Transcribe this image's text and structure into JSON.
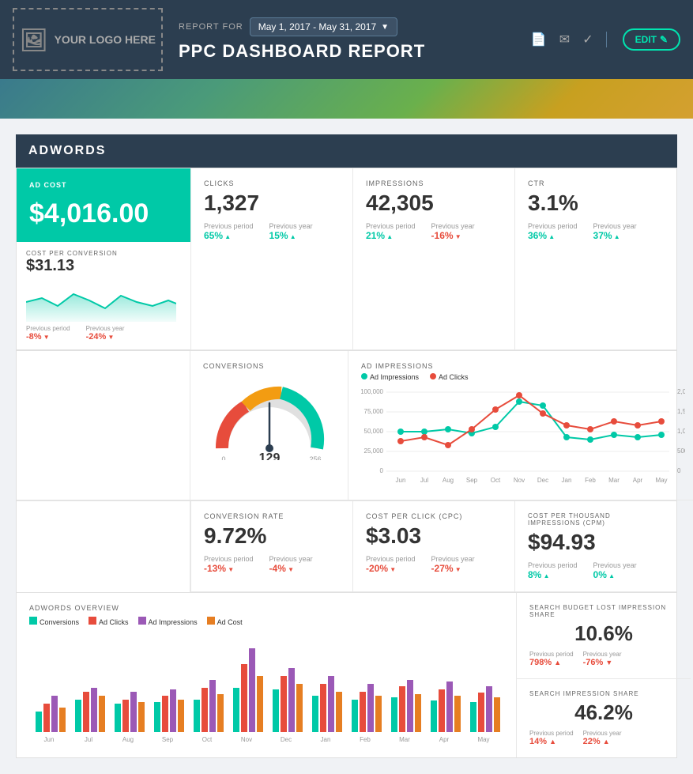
{
  "header": {
    "logo_text": "YOUR LOGO HERE",
    "report_for_label": "REPORT FOR",
    "date_range": "May 1, 2017 - May 31, 2017",
    "page_title": "PPC DASHBOARD REPORT",
    "edit_label": "EDIT",
    "icons": [
      "pdf-icon",
      "email-icon",
      "check-icon"
    ]
  },
  "adwords": {
    "section_label": "ADWORDS",
    "ad_cost": {
      "label": "AD COST",
      "value": "$4,016.00",
      "cost_per_conv_label": "COST PER CONVERSION",
      "cost_per_conv_value": "$31.13",
      "prev_period_label": "Previous period",
      "prev_period_value": "-8%",
      "prev_year_label": "Previous year",
      "prev_year_value": "-24%"
    },
    "clicks": {
      "label": "CLICKS",
      "value": "1,327",
      "prev_period_label": "Previous period",
      "prev_period_value": "65%",
      "prev_year_label": "Previous year",
      "prev_year_value": "15%"
    },
    "impressions": {
      "label": "IMPRESSIONS",
      "value": "42,305",
      "prev_period_label": "Previous period",
      "prev_period_value": "21%",
      "prev_year_label": "Previous year",
      "prev_year_value": "-16%"
    },
    "ctr": {
      "label": "CTR",
      "value": "3.1%",
      "prev_period_label": "Previous period",
      "prev_period_value": "36%",
      "prev_year_label": "Previous year",
      "prev_year_value": "37%"
    },
    "conversions": {
      "label": "CONVERSIONS",
      "value": "129",
      "min": "0",
      "max": "256"
    },
    "ad_impressions_chart": {
      "label": "AD IMPRESSIONS",
      "legend_impressions": "Ad Impressions",
      "legend_clicks": "Ad Clicks",
      "months": [
        "Jun",
        "Jul",
        "Aug",
        "Sep",
        "Oct",
        "Nov",
        "Dec",
        "Jan",
        "Feb",
        "Mar",
        "Apr",
        "May"
      ]
    },
    "conversion_rate": {
      "label": "CONVERSION RATE",
      "value": "9.72%",
      "prev_period_label": "Previous period",
      "prev_period_value": "-13%",
      "prev_year_label": "Previous year",
      "prev_year_value": "-4%"
    },
    "cpc": {
      "label": "COST PER CLICK (CPC)",
      "value": "$3.03",
      "prev_period_label": "Previous period",
      "prev_period_value": "-20%",
      "prev_year_label": "Previous year",
      "prev_year_value": "-27%"
    },
    "cpm": {
      "label": "COST PER THOUSAND IMPRESSIONS (CPM)",
      "value": "$94.93",
      "prev_period_label": "Previous period",
      "prev_period_value": "8%",
      "prev_year_label": "Previous year",
      "prev_year_value": "0%"
    },
    "overview": {
      "label": "ADWORDS OVERVIEW",
      "legend_conversions": "Conversions",
      "legend_ad_clicks": "Ad Clicks",
      "legend_ad_impressions": "Ad Impressions",
      "legend_ad_cost": "Ad Cost",
      "months": [
        "Jun",
        "Jul",
        "Aug",
        "Sep",
        "Oct",
        "Nov",
        "Dec",
        "Jan",
        "Feb",
        "Mar",
        "Apr",
        "May"
      ]
    },
    "search_budget": {
      "label": "SEARCH BUDGET LOST IMPRESSION SHARE",
      "value": "10.6%",
      "prev_period_label": "Previous period",
      "prev_period_value": "798%",
      "prev_year_label": "Previous year",
      "prev_year_value": "-76%"
    },
    "search_impression": {
      "label": "SEARCH IMPRESSION SHARE",
      "value": "46.2%",
      "prev_period_label": "Previous period",
      "prev_period_value": "14%",
      "prev_year_label": "Previous year",
      "prev_year_value": "22%"
    }
  }
}
